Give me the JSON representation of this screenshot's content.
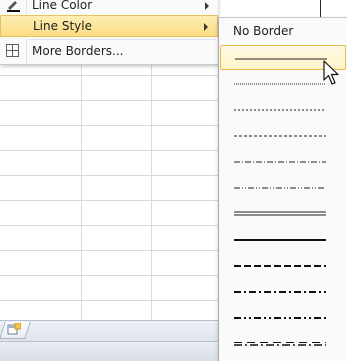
{
  "main_menu": {
    "items": [
      {
        "label": "Line Color",
        "has_submenu": true,
        "icon": "pencil-icon"
      },
      {
        "label": "Line Style",
        "has_submenu": true,
        "highlighted": true
      },
      {
        "label": "More Borders...",
        "icon": "borders-grid-icon"
      }
    ]
  },
  "line_style_menu": {
    "no_border_label": "No Border",
    "styles": [
      {
        "name": "thin-solid",
        "selected": true
      },
      {
        "name": "hair"
      },
      {
        "name": "dotted"
      },
      {
        "name": "dash-dot"
      },
      {
        "name": "dash-dot-dot"
      },
      {
        "name": "double"
      },
      {
        "name": "medium-solid"
      },
      {
        "name": "medium-dashed"
      },
      {
        "name": "medium-dash-dot"
      },
      {
        "name": "medium-dash-dot-dot"
      },
      {
        "name": "slant-dash-dot"
      }
    ]
  },
  "colors": {
    "highlight": "#fbdc84",
    "selected_border": "#e4b94d",
    "gridline": "#d6dbe2"
  }
}
